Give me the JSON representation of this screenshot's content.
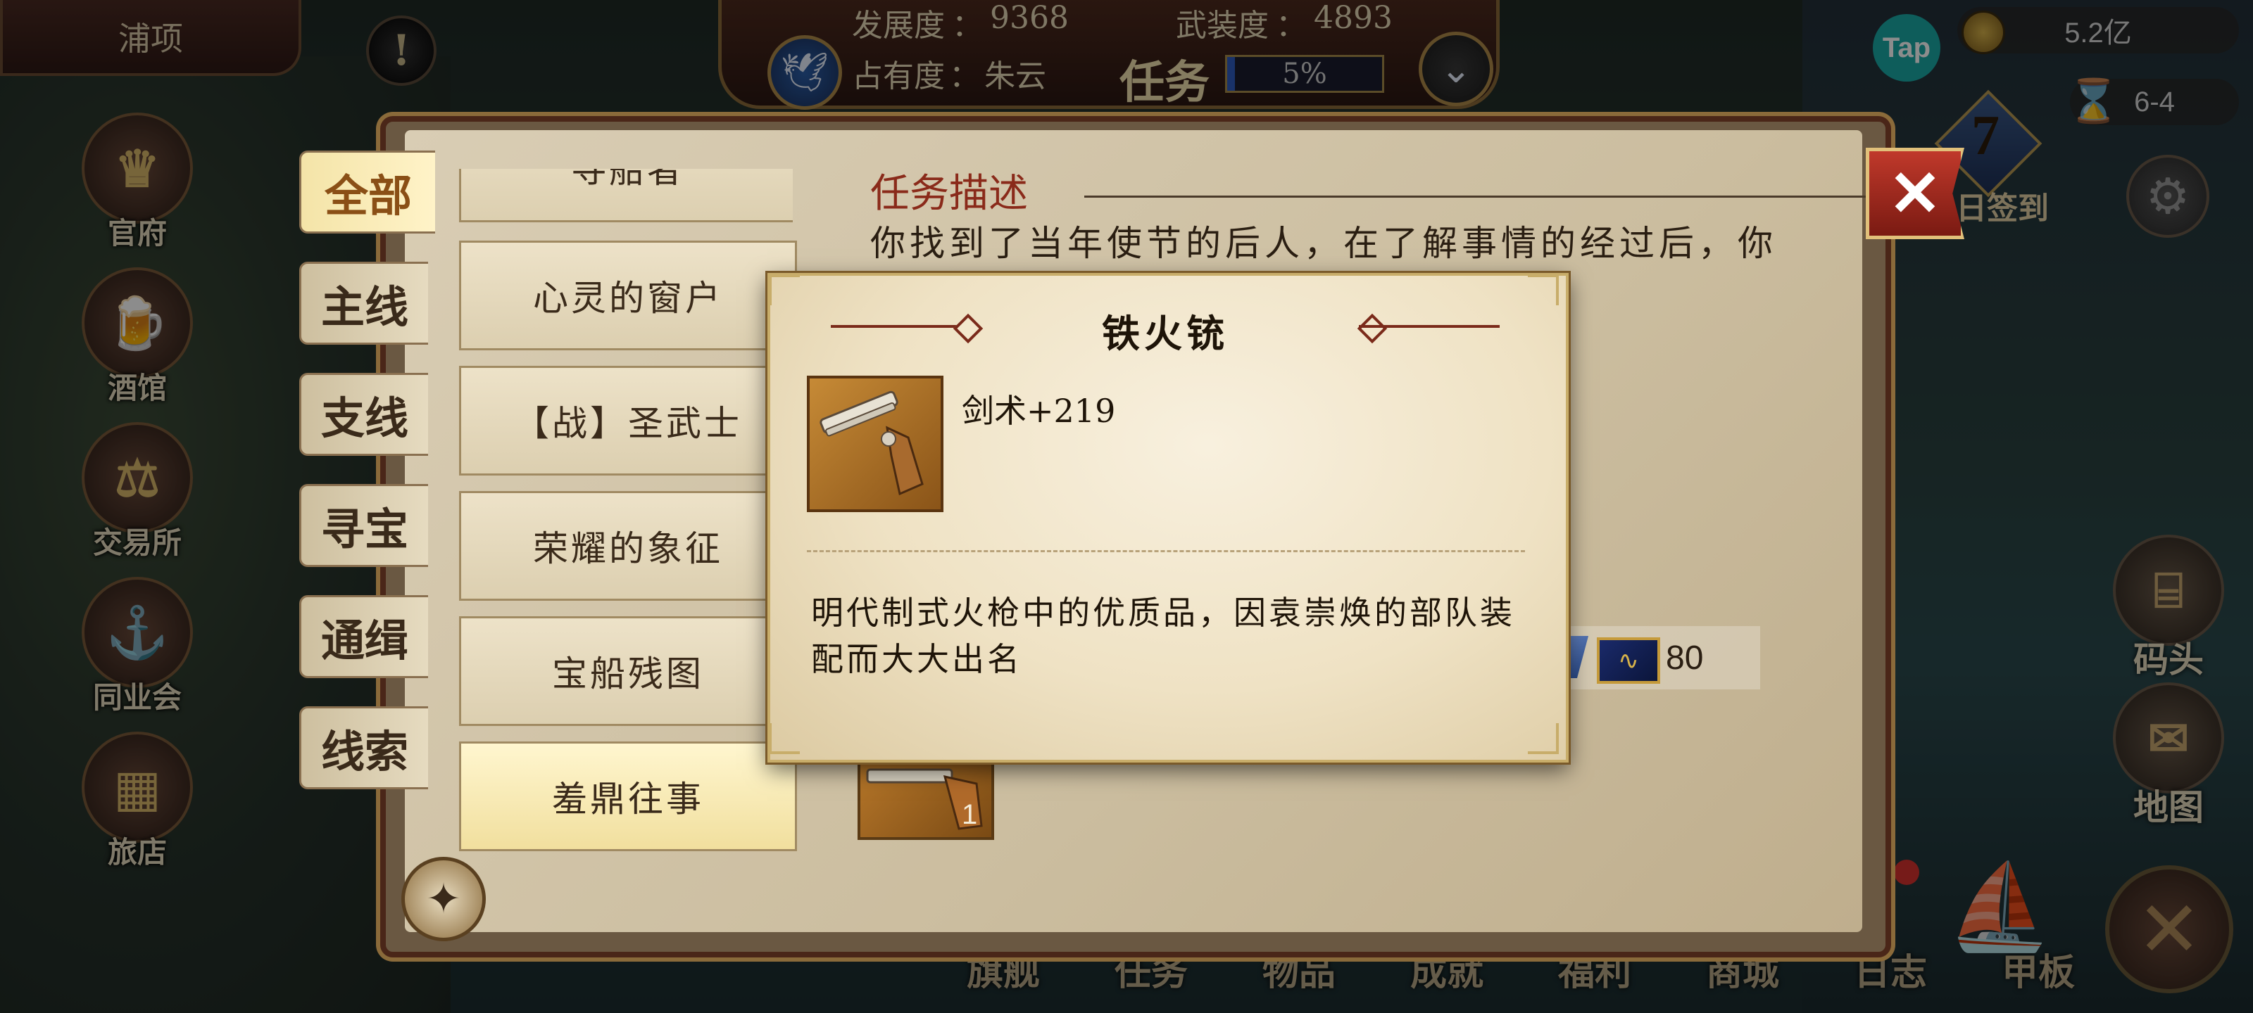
{
  "location": "浦项",
  "status": {
    "development_label": "发展度",
    "development_value": "9368",
    "armament_label": "武装度",
    "armament_value": "4893",
    "occupation_label": "占有度",
    "occupation_value": "朱云",
    "screen_title": "任务",
    "progress_text": "5%",
    "progress_fraction": 0.05
  },
  "currency": {
    "gold": "5.2亿",
    "time": "6-4"
  },
  "tap_label": "Tap",
  "checkin": {
    "day": "7",
    "label": "日签到"
  },
  "left_sidebar": [
    {
      "label": "官府",
      "icon": "crown-icon",
      "glyph": "♛"
    },
    {
      "label": "酒馆",
      "icon": "tavern-icon",
      "glyph": "🍺"
    },
    {
      "label": "交易所",
      "icon": "scales-icon",
      "glyph": "⚖"
    },
    {
      "label": "同业会",
      "icon": "anchor-icon",
      "glyph": "⚓"
    },
    {
      "label": "旅店",
      "icon": "inn-icon",
      "glyph": "▦"
    }
  ],
  "right_sidebar": [
    {
      "label": "码头",
      "icon": "dock-icon",
      "glyph": "⌸"
    },
    {
      "label": "地图",
      "icon": "map-icon",
      "glyph": "✉"
    }
  ],
  "bottom_nav": [
    "旗舰",
    "任务",
    "物品",
    "成就",
    "福利",
    "商城",
    "日志",
    "甲板"
  ],
  "categories": [
    "全部",
    "主线",
    "支线",
    "寻宝",
    "通缉",
    "线索"
  ],
  "active_category": "全部",
  "quests": [
    "寻船者",
    "心灵的窗户",
    "【战】圣武士",
    "荣耀的象征",
    "宝船残图",
    "羞鼎往事"
  ],
  "active_quest": "羞鼎往事",
  "task": {
    "desc_title": "任务描述",
    "desc_text": "你找到了当年使节的后人，在了解事情的经过后，你",
    "reward_value": "80",
    "item_count": "1"
  },
  "tooltip": {
    "title": "铁火铳",
    "stat": "剑术+219",
    "description_line1": "明代制式火枪中的优质品，因袁崇焕的部队装",
    "description_line2": "配而大大出名"
  },
  "colors": {
    "accent_gold": "#c8ad6a",
    "panel_paper": "#d9cdb4",
    "close_red": "#c0392b"
  }
}
